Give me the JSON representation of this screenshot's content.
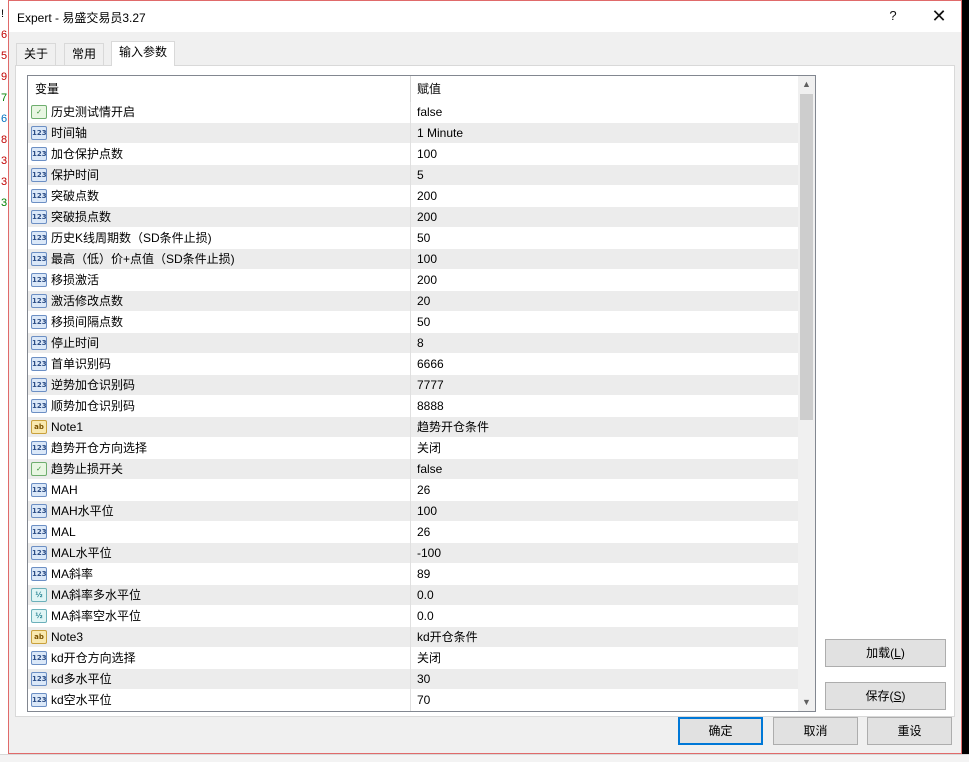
{
  "background": {
    "left_column": [
      {
        "text": "!",
        "color": "#000000"
      },
      {
        "text": "6",
        "color": "#c00000"
      },
      {
        "text": "5",
        "color": "#c00000"
      },
      {
        "text": "9",
        "color": "#c00000"
      },
      {
        "text": "7",
        "color": "#008000"
      },
      {
        "text": "6",
        "color": "#0070c0"
      },
      {
        "text": "8",
        "color": "#c00000"
      },
      {
        "text": "3",
        "color": "#c00000"
      },
      {
        "text": "3",
        "color": "#c00000"
      },
      {
        "text": "3",
        "color": "#008000"
      }
    ]
  },
  "window": {
    "title": "Expert - 易盛交易员3.27",
    "help_glyph": "?",
    "close_glyph": "✕"
  },
  "tabs": [
    {
      "label": "关于",
      "active": false
    },
    {
      "label": "常用",
      "active": false
    },
    {
      "label": "输入参数",
      "active": true
    }
  ],
  "grid": {
    "headers": {
      "name": "变量",
      "value": "赋值"
    },
    "rows": [
      {
        "icon": "bool",
        "icon_text": "✓",
        "name": "历史测试情开启",
        "value": "false"
      },
      {
        "icon": "num",
        "icon_text": "123",
        "name": "时间轴",
        "value": "1 Minute"
      },
      {
        "icon": "num",
        "icon_text": "123",
        "name": "加仓保护点数",
        "value": "100"
      },
      {
        "icon": "num",
        "icon_text": "123",
        "name": "保护时间",
        "value": "5"
      },
      {
        "icon": "num",
        "icon_text": "123",
        "name": "突破点数",
        "value": "200"
      },
      {
        "icon": "num",
        "icon_text": "123",
        "name": "突破损点数",
        "value": "200"
      },
      {
        "icon": "num",
        "icon_text": "123",
        "name": "历史K线周期数（SD条件止损)",
        "value": "50"
      },
      {
        "icon": "num",
        "icon_text": "123",
        "name": "最高（低）价+点值（SD条件止损)",
        "value": "100"
      },
      {
        "icon": "num",
        "icon_text": "123",
        "name": "移损激活",
        "value": "200"
      },
      {
        "icon": "num",
        "icon_text": "123",
        "name": "激活修改点数",
        "value": "20"
      },
      {
        "icon": "num",
        "icon_text": "123",
        "name": "移损间隔点数",
        "value": "50"
      },
      {
        "icon": "num",
        "icon_text": "123",
        "name": "停止时间",
        "value": "8"
      },
      {
        "icon": "num",
        "icon_text": "123",
        "name": "首单识别码",
        "value": "6666"
      },
      {
        "icon": "num",
        "icon_text": "123",
        "name": "逆势加仓识别码",
        "value": "7777"
      },
      {
        "icon": "num",
        "icon_text": "123",
        "name": "顺势加仓识别码",
        "value": "8888"
      },
      {
        "icon": "str",
        "icon_text": "ab",
        "name": "Note1",
        "value": "趋势开仓条件"
      },
      {
        "icon": "num",
        "icon_text": "123",
        "name": "趋势开仓方向选择",
        "value": "关闭"
      },
      {
        "icon": "bool",
        "icon_text": "✓",
        "name": "趋势止损开关",
        "value": "false"
      },
      {
        "icon": "num",
        "icon_text": "123",
        "name": "MAH",
        "value": "26"
      },
      {
        "icon": "num",
        "icon_text": "123",
        "name": "MAH水平位",
        "value": "100"
      },
      {
        "icon": "num",
        "icon_text": "123",
        "name": "MAL",
        "value": "26"
      },
      {
        "icon": "num",
        "icon_text": "123",
        "name": "MAL水平位",
        "value": "-100"
      },
      {
        "icon": "num",
        "icon_text": "123",
        "name": "MA斜率",
        "value": "89"
      },
      {
        "icon": "dbl",
        "icon_text": "½",
        "name": "MA斜率多水平位",
        "value": "0.0"
      },
      {
        "icon": "dbl",
        "icon_text": "½",
        "name": "MA斜率空水平位",
        "value": "0.0"
      },
      {
        "icon": "str",
        "icon_text": "ab",
        "name": "Note3",
        "value": "kd开仓条件"
      },
      {
        "icon": "num",
        "icon_text": "123",
        "name": "kd开仓方向选择",
        "value": "关闭"
      },
      {
        "icon": "num",
        "icon_text": "123",
        "name": "kd多水平位",
        "value": "30"
      },
      {
        "icon": "num",
        "icon_text": "123",
        "name": "kd空水平位",
        "value": "70"
      }
    ]
  },
  "scrollbar": {
    "up_glyph": "▲",
    "down_glyph": "▼"
  },
  "buttons": {
    "load": {
      "label": "加载",
      "hotkey": "L"
    },
    "save": {
      "label": "保存",
      "hotkey": "S"
    },
    "ok": "确定",
    "cancel": "取消",
    "reset": "重设"
  }
}
